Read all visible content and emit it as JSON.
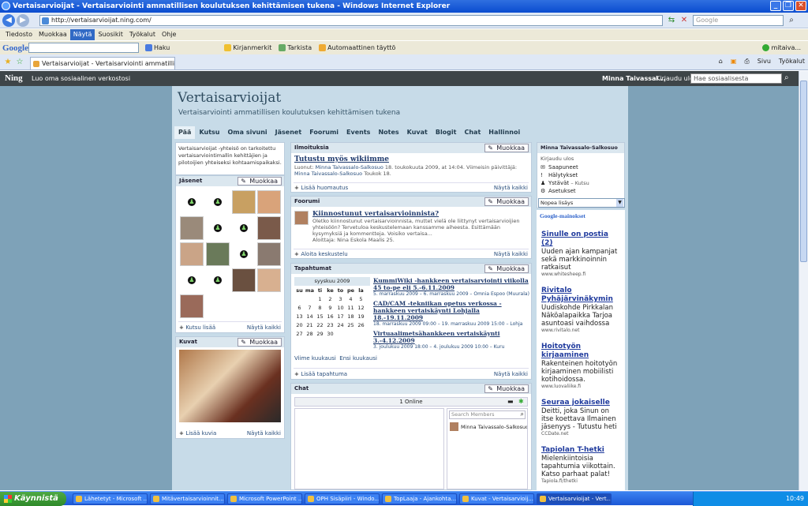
{
  "window": {
    "title": "Vertaisarvioijat - Vertaisarviointi ammatillisen koulutuksen kehittämisen tukena - Windows Internet Explorer"
  },
  "ie": {
    "address": "http://vertaisarvioijat.ning.com/",
    "search_placeholder": "Google",
    "menu": [
      "Tiedosto",
      "Muokkaa",
      "Näytä",
      "Suosikit",
      "Työkalut",
      "Ohje"
    ],
    "active_menu": "Näytä",
    "google_logo": "Google",
    "google_tools": [
      "Haku",
      "Kirjanmerkit",
      "Tarkista",
      "Automaattinen täyttö"
    ],
    "google_user": "mitaiva...",
    "tab_title": "Vertaisarvioijat - Vertaisarviointi ammatillisen koulutuk...",
    "tab_tools": [
      "Sivu",
      "Työkalut"
    ]
  },
  "ning": {
    "logo": "Ning",
    "tagline": "Luo oma sosiaalinen verkostosi",
    "user": "Minna Taivassal...",
    "logout": "Kirjaudu ulos",
    "search_placeholder": "Hae sosiaalisesta verkostosta"
  },
  "site": {
    "title": "Vertaisarvioijat",
    "subtitle": "Vertaisarviointi ammatillisen koulutuksen kehittämisen tukena",
    "nav": [
      "Pää",
      "Kutsu",
      "Oma sivuni",
      "Jäsenet",
      "Foorumi",
      "Events",
      "Notes",
      "Kuvat",
      "Blogit",
      "Chat",
      "Hallinnoi"
    ],
    "nav_current": "Pää"
  },
  "intro": {
    "text": "Vertaisarvioijat -yhteisö on tarkoitettu vertaisarviointimallin kehittäjien ja pilotoijien yhteiseksi kohtaamispaikaksi."
  },
  "edit_label": "Muokkaa",
  "members": {
    "title": "Jäsenet",
    "invite": "Kutsu lisää",
    "show_all": "Näytä kaikki"
  },
  "photos": {
    "title": "Kuvat",
    "add": "Lisää kuvia",
    "show_all": "Näytä kaikki"
  },
  "announcements": {
    "title": "Ilmoituksia",
    "post_title": "Tutustu myös wikiimme",
    "meta_created": "Luonut:",
    "meta_author": "Minna Taivassalo-Salkosuo",
    "meta_date": "18. toukokuuta 2009, at 14:04. Viimeisin päivittäjä:",
    "meta_editor": "Minna Taivassalo-Salkosuo",
    "meta_edit_date": "Toukok 18.",
    "add": "Lisää huomautus",
    "show_all": "Näytä kaikki"
  },
  "forum": {
    "title": "Foorumi",
    "post_title": "Kiinnostunut vertaisarvioinnista?",
    "post_body": "Oletko kiinnostunut vertaisarvioinnista, muttet vielä ole liittynyt vertaisarvioijien yhteisöön? Tervetuloa keskustelemaan kanssamme aiheesta. Esittämään kysymyksiä ja kommentteja. Voisiko vertaisa...",
    "post_meta": "Aloittaja: Nina Eskola Maalis 25.",
    "start": "Aloita keskustelu",
    "show_all": "Näytä kaikki"
  },
  "events": {
    "title": "Tapahtumat",
    "month": "syyskuu 2009",
    "weekdays": [
      "su",
      "ma",
      "ti",
      "ke",
      "to",
      "pe",
      "la"
    ],
    "weeks": [
      [
        "",
        "",
        "1",
        "2",
        "3",
        "4",
        "5"
      ],
      [
        "6",
        "7",
        "8",
        "9",
        "10",
        "11",
        "12"
      ],
      [
        "13",
        "14",
        "15",
        "16",
        "17",
        "18",
        "19"
      ],
      [
        "20",
        "21",
        "22",
        "23",
        "24",
        "25",
        "26"
      ],
      [
        "27",
        "28",
        "29",
        "30",
        "",
        "",
        ""
      ]
    ],
    "items": [
      {
        "title": "KummiWiki -hankkeen vertaisarviointi viikolla 45 to-pe eli 5.-6.11.2009",
        "when": "5. marraskuu 2009 – 6. marraskuu 2009 –",
        "where": "Omnia Espoo (Muurala)"
      },
      {
        "title": "CAD/CAM -tekniikan opetus verkossa -hankkeen vertaiskäynti Lohjalla 18.-19.11.2009",
        "when": "18. marraskuu 2009 09:00 – 19. marraskuu 2009 15:00 –",
        "where": "Lohja"
      },
      {
        "title": "Virtuaalimetsähankkeen vertaiskäynti 3.-4.12.2009",
        "when": "3. joulukuu 2009 18:00 – 4. joulukuu 2009 10:00 –",
        "where": "Kuru"
      }
    ],
    "past": "Viime kuukausi",
    "next": "Ensi kuukausi",
    "add": "Lisää tapahtuma",
    "show_all": "Näytä kaikki"
  },
  "chat": {
    "title": "Chat",
    "online": "1 Online",
    "search_placeholder": "Search Members",
    "member": "Minna Taivassalo-Salkosuo"
  },
  "profile": {
    "title": "Minna Taivassalo-Salkosuo",
    "logout": "Kirjaudu ulos",
    "links": [
      {
        "icon": "envelope-icon",
        "label": "Saapuneet"
      },
      {
        "icon": "alert-icon",
        "label": "Hälytykset"
      },
      {
        "icon": "person-icon",
        "label": "Ystävät",
        "extra": "– Kutsu"
      },
      {
        "icon": "gear-icon",
        "label": "Asetukset"
      }
    ],
    "quick_add": "Nopea lisäys"
  },
  "ads": {
    "header": "Google-mainokset",
    "items": [
      {
        "title": "Sinulle on postia (2)",
        "text": "Uuden ajan kampanjat sekä markkinoinnin ratkaisut",
        "url": "www.whitesheep.fi"
      },
      {
        "title": "Rivitalo Pyhäjärvinäkymin",
        "text": "Uudiskohde Pirkkalan Näköalapaikka Tarjoa asuntoasi vaihdossa",
        "url": "www.rivitalo.net"
      },
      {
        "title": "Hoitotyön kirjaaminen",
        "text": "Rakenteinen hoitotyön kirjaaminen mobiilisti kotihoidossa.",
        "url": "www.luovaliike.fi"
      },
      {
        "title": "Seuraa jokaiselle",
        "text": "Deitti, joka Sinun on itse koettava Ilmainen jäsenyys - Tutustu heti",
        "url": "CCDate.net"
      },
      {
        "title": "Tapiolan T-hetki",
        "text": "Mielenkiintoisia tapahtumia viikottain. Katso parhaat palat!",
        "url": "Tapiola.fi/thetki"
      }
    ]
  },
  "taskbar": {
    "start": "Käynnistä",
    "tasks": [
      "Lähetetyt - Microsoft ...",
      "Mitävertaisarvioinnit...",
      "Microsoft PowerPoint ...",
      "OPH Sisäpiiri - Windo...",
      "TopLaaja - Ajankohta...",
      "Kuvat - Vertaisarvioij...",
      "Vertaisarvioijat - Vert..."
    ],
    "clock": "10:49"
  },
  "colors": {
    "page_bg": "#7ea2b8",
    "content_bg": "#c7dbe8",
    "ning_bar": "#3e4548",
    "link": "#2a4f7d"
  }
}
